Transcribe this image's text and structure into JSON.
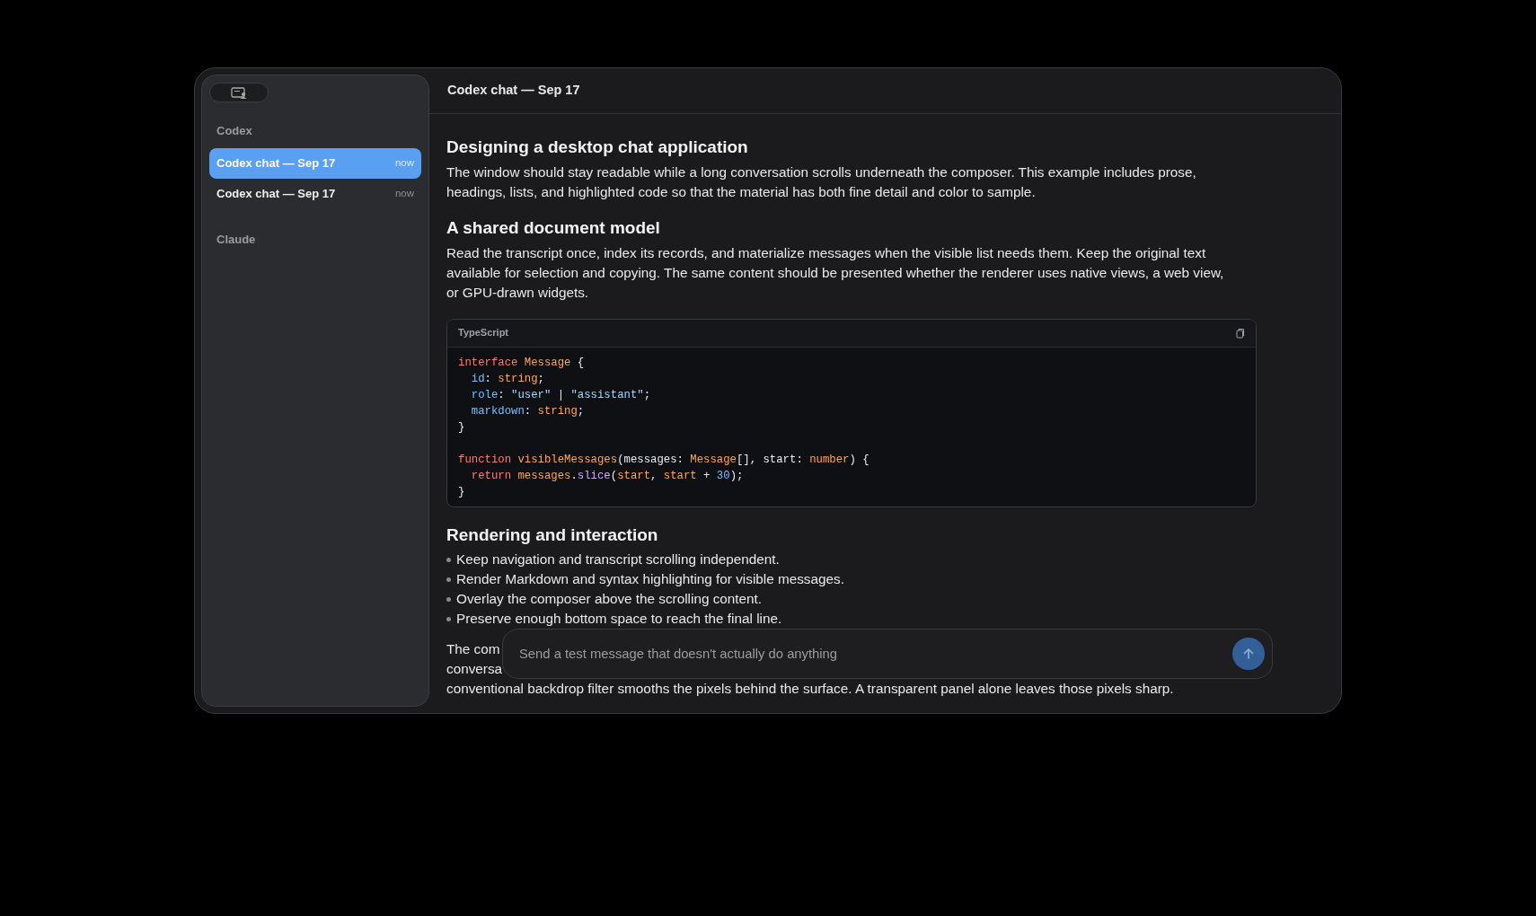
{
  "sidebar": {
    "groups": [
      {
        "label": "Codex",
        "items": [
          {
            "title": "Codex chat — Sep 17",
            "time": "now",
            "selected": true
          },
          {
            "title": "Codex chat — Sep 17",
            "time": "now",
            "selected": false
          }
        ]
      },
      {
        "label": "Claude"
      }
    ]
  },
  "header": {
    "title": "Codex chat — Sep 17"
  },
  "content": [
    {
      "kind": "heading",
      "text": "Designing a desktop chat application"
    },
    {
      "kind": "paragraph",
      "text": "The window should stay readable while a long conversation scrolls underneath the composer. This example includes prose, headings, lists, and highlighted code so that the material has both fine detail and color to sample."
    },
    {
      "kind": "heading",
      "text": "A shared document model"
    },
    {
      "kind": "paragraph",
      "text": "Read the transcript once, index its records, and materialize messages when the visible list needs them. Keep the original text available for selection and copying. The same content should be presented whether the renderer uses native views, a web view, or GPU-drawn widgets."
    },
    {
      "kind": "code",
      "language": "TypeScript",
      "lines": [
        {
          "tokens": [
            {
              "kind": "keyword",
              "text": "interface"
            },
            {
              "kind": "type",
              "text": " Message"
            },
            {
              "kind": "plain",
              "text": " {"
            }
          ]
        },
        {
          "indent": true,
          "tokens": [
            {
              "kind": "property",
              "text": "id"
            },
            {
              "kind": "plain",
              "text": ":"
            },
            {
              "kind": "type",
              "text": " string"
            },
            {
              "kind": "plain",
              "text": ";"
            }
          ]
        },
        {
          "indent": true,
          "tokens": [
            {
              "kind": "property",
              "text": "role"
            },
            {
              "kind": "plain",
              "text": ":"
            },
            {
              "kind": "string",
              "text": " \"user\""
            },
            {
              "kind": "plain",
              "text": " |"
            },
            {
              "kind": "string",
              "text": " \"assistant\""
            },
            {
              "kind": "plain",
              "text": ";"
            }
          ]
        },
        {
          "indent": true,
          "tokens": [
            {
              "kind": "property",
              "text": "markdown"
            },
            {
              "kind": "plain",
              "text": ":"
            },
            {
              "kind": "type",
              "text": " string"
            },
            {
              "kind": "plain",
              "text": ";"
            }
          ]
        },
        {
          "tokens": [
            {
              "kind": "plain",
              "text": "}"
            }
          ]
        },
        {
          "gap_before": true,
          "tokens": [
            {
              "kind": "keyword",
              "text": "function"
            },
            {
              "kind": "type",
              "text": " visibleMessages"
            },
            {
              "kind": "plain",
              "text": "(messages:"
            },
            {
              "kind": "type",
              "text": " Message"
            },
            {
              "kind": "plain",
              "text": "[], start:"
            },
            {
              "kind": "type",
              "text": " number"
            },
            {
              "kind": "plain",
              "text": ") {"
            }
          ]
        },
        {
          "indent": true,
          "tokens": [
            {
              "kind": "keyword",
              "text": "return"
            },
            {
              "kind": "type",
              "text": " messages"
            },
            {
              "kind": "plain",
              "text": "."
            },
            {
              "kind": "function",
              "text": "slice"
            },
            {
              "kind": "plain",
              "text": "("
            },
            {
              "kind": "type",
              "text": "start"
            },
            {
              "kind": "plain",
              "text": ","
            },
            {
              "kind": "type",
              "text": " start"
            },
            {
              "kind": "plain",
              "text": " +"
            },
            {
              "kind": "number",
              "text": " 30"
            },
            {
              "kind": "plain",
              "text": ");"
            }
          ]
        },
        {
          "tokens": [
            {
              "kind": "plain",
              "text": "}"
            }
          ]
        }
      ]
    },
    {
      "kind": "heading",
      "text": "Rendering and interaction"
    },
    {
      "kind": "list",
      "items": [
        "Keep navigation and transcript scrolling independent.",
        "Render Markdown and syntax highlighting for visible messages.",
        "Overlay the composer above the scrolling content.",
        "Preserve enough bottom space to reach the final line."
      ]
    },
    {
      "kind": "partial",
      "lines": [
        "The com",
        "conversa",
        "conventional backdrop filter smooths the pixels behind the surface. A transparent panel alone leaves those pixels sharp."
      ]
    }
  ],
  "composer": {
    "placeholder": "Send a test message that doesn't actually do anything"
  }
}
